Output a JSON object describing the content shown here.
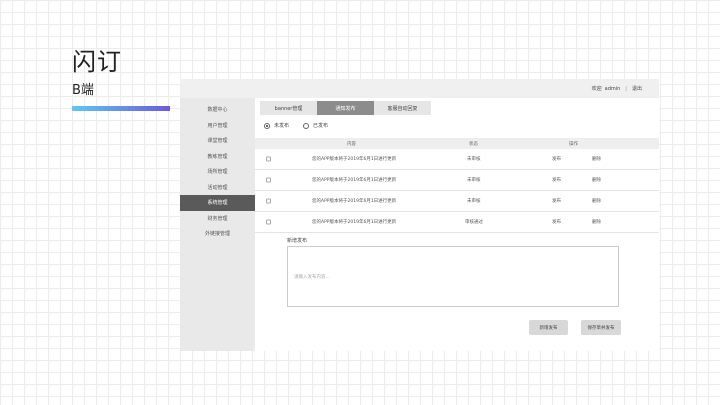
{
  "slide": {
    "title": "闪订",
    "subtitle": "B端"
  },
  "topbar": {
    "welcome": "欢迎",
    "user": "admin",
    "separator": "|",
    "logout": "退出"
  },
  "sidebar": {
    "items": [
      {
        "label": "数据中心",
        "active": false
      },
      {
        "label": "用户管理",
        "active": false
      },
      {
        "label": "课堂管理",
        "active": false
      },
      {
        "label": "教练管理",
        "active": false
      },
      {
        "label": "场所管理",
        "active": false
      },
      {
        "label": "活动管理",
        "active": false
      },
      {
        "label": "系统管理",
        "active": true
      },
      {
        "label": "财务管理",
        "active": false
      },
      {
        "label": "外链接管理",
        "active": false
      }
    ]
  },
  "tabs": [
    {
      "label": "banner管理",
      "active": false
    },
    {
      "label": "通知发布",
      "active": true
    },
    {
      "label": "客服自动回复",
      "active": false
    }
  ],
  "filters": {
    "unpublished": "未发布",
    "published": "已发布"
  },
  "table": {
    "headers": {
      "content": "内容",
      "status": "状态",
      "action": "操作"
    },
    "rows": [
      {
        "content": "您的APP版本将于2019年6月1日进行更新",
        "status": "未审核",
        "action1": "发布",
        "action2": "删除"
      },
      {
        "content": "您的APP版本将于2019年6月1日进行更新",
        "status": "未审核",
        "action1": "发布",
        "action2": "删除"
      },
      {
        "content": "您的APP版本将于2019年6月1日进行更新",
        "status": "未审核",
        "action1": "发布",
        "action2": "删除"
      },
      {
        "content": "您的APP版本将于2019年6月1日进行更新",
        "status": "审核通过",
        "action1": "发布",
        "action2": "删除"
      }
    ]
  },
  "compose": {
    "label": "新增发布",
    "placeholder": "请输入发布内容...",
    "save_button": "新增发布",
    "publish_button": "保存草并发布"
  }
}
